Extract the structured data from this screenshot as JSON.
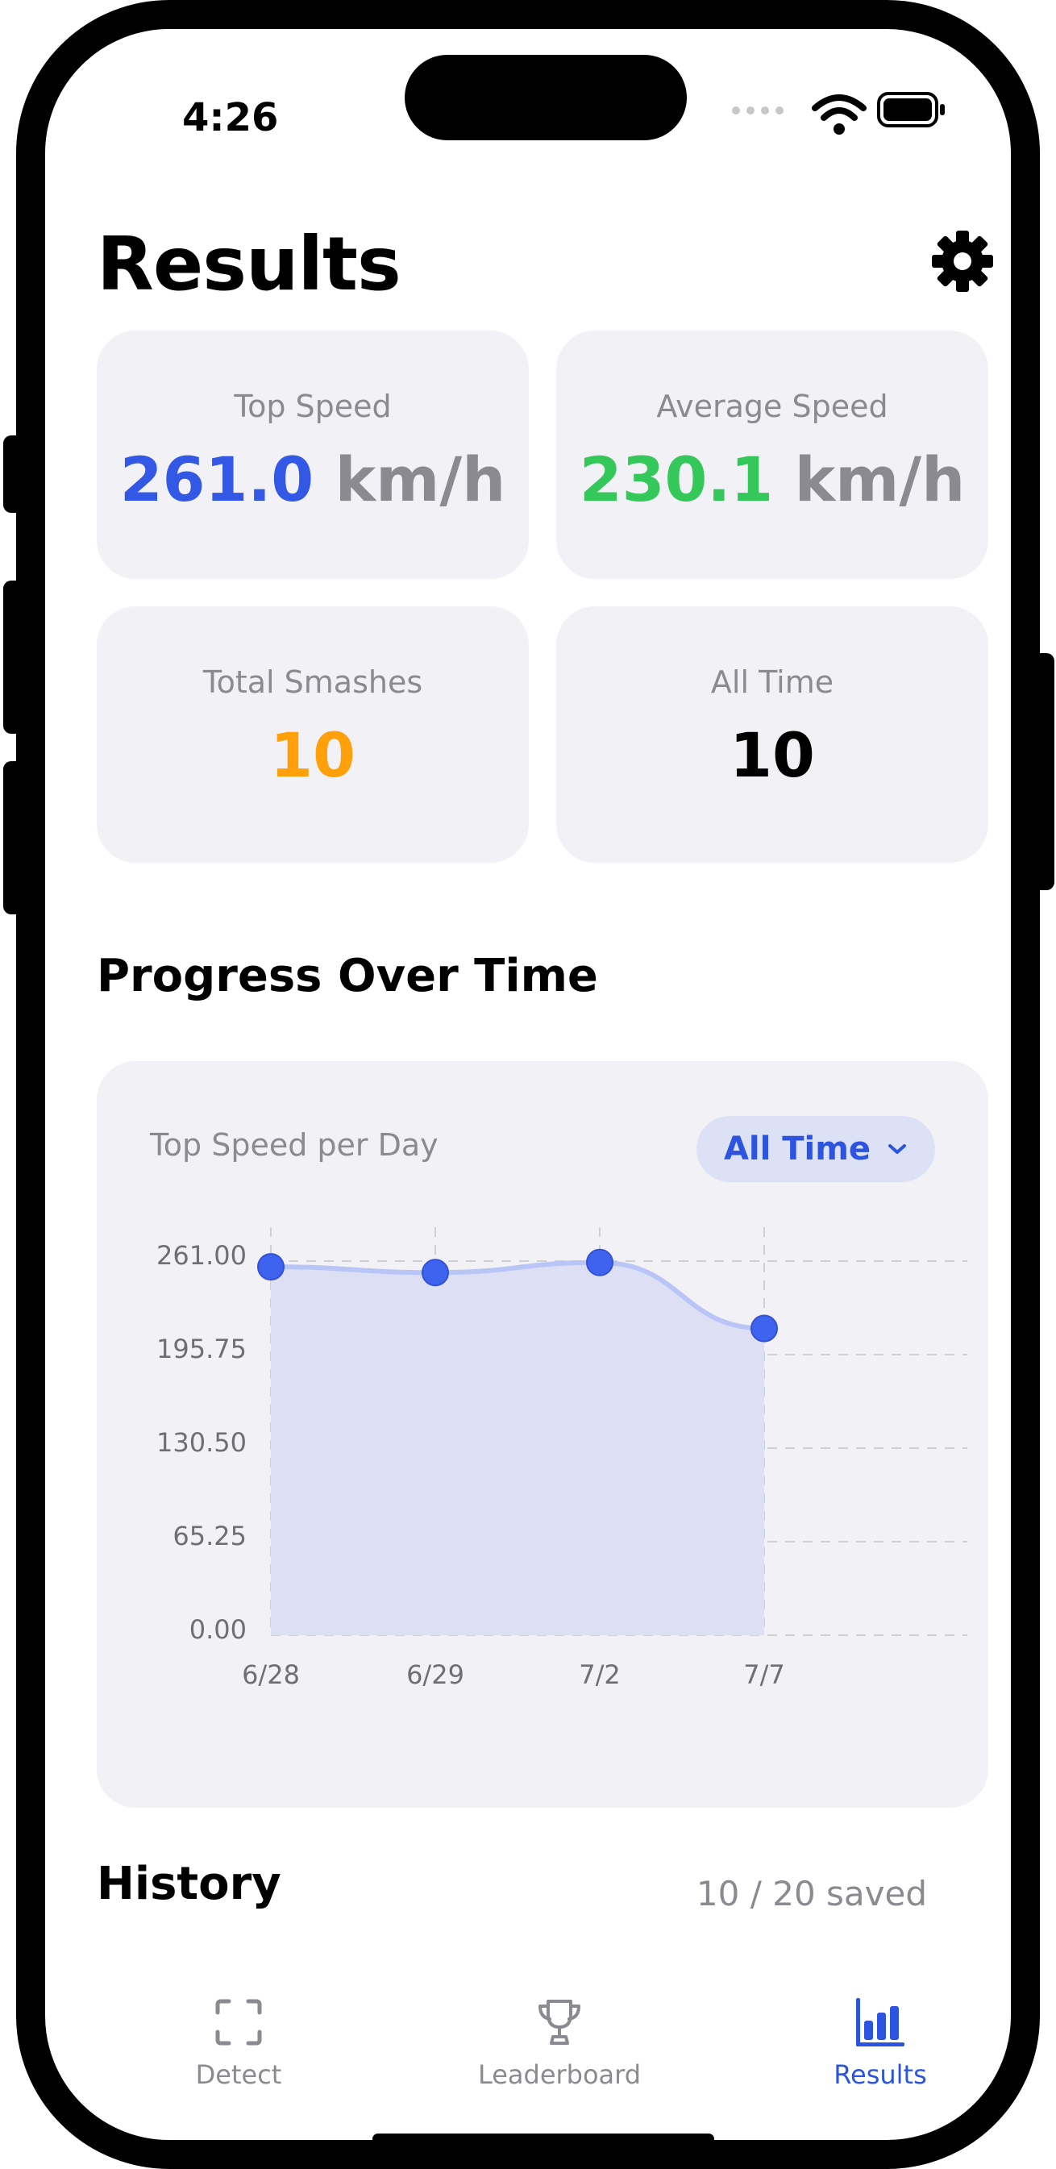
{
  "status_bar": {
    "time": "4:26"
  },
  "header": {
    "title": "Results"
  },
  "stats": [
    {
      "label": "Top Speed",
      "value": "261.0",
      "unit": "km/h",
      "color": "#3358e6"
    },
    {
      "label": "Average Speed",
      "value": "230.1",
      "unit": "km/h",
      "color": "#34c759"
    },
    {
      "label": "Total Smashes",
      "value": "10",
      "unit": "",
      "color": "#ff9f0a"
    },
    {
      "label": "All Time",
      "value": "10",
      "unit": "",
      "color": "#000000"
    }
  ],
  "progress": {
    "section_title": "Progress Over Time",
    "chart_title": "Top Speed per Day",
    "range_selector": "All Time"
  },
  "chart_data": {
    "type": "area",
    "title": "Top Speed per Day",
    "categories": [
      "6/28",
      "6/29",
      "7/2",
      "7/7"
    ],
    "values": [
      257,
      253,
      260,
      214
    ],
    "ylim": [
      0,
      261
    ],
    "yticks": [
      "261.00",
      "195.75",
      "130.50",
      "65.25",
      "0.00"
    ],
    "grid": true,
    "color": "#3d63ef"
  },
  "history": {
    "title": "History",
    "saved": "10 / 20 saved"
  },
  "tabs": [
    {
      "label": "Detect",
      "icon": "scan-icon",
      "active": false
    },
    {
      "label": "Leaderboard",
      "icon": "trophy-icon",
      "active": false
    },
    {
      "label": "Results",
      "icon": "bar-chart-icon",
      "active": true
    }
  ]
}
